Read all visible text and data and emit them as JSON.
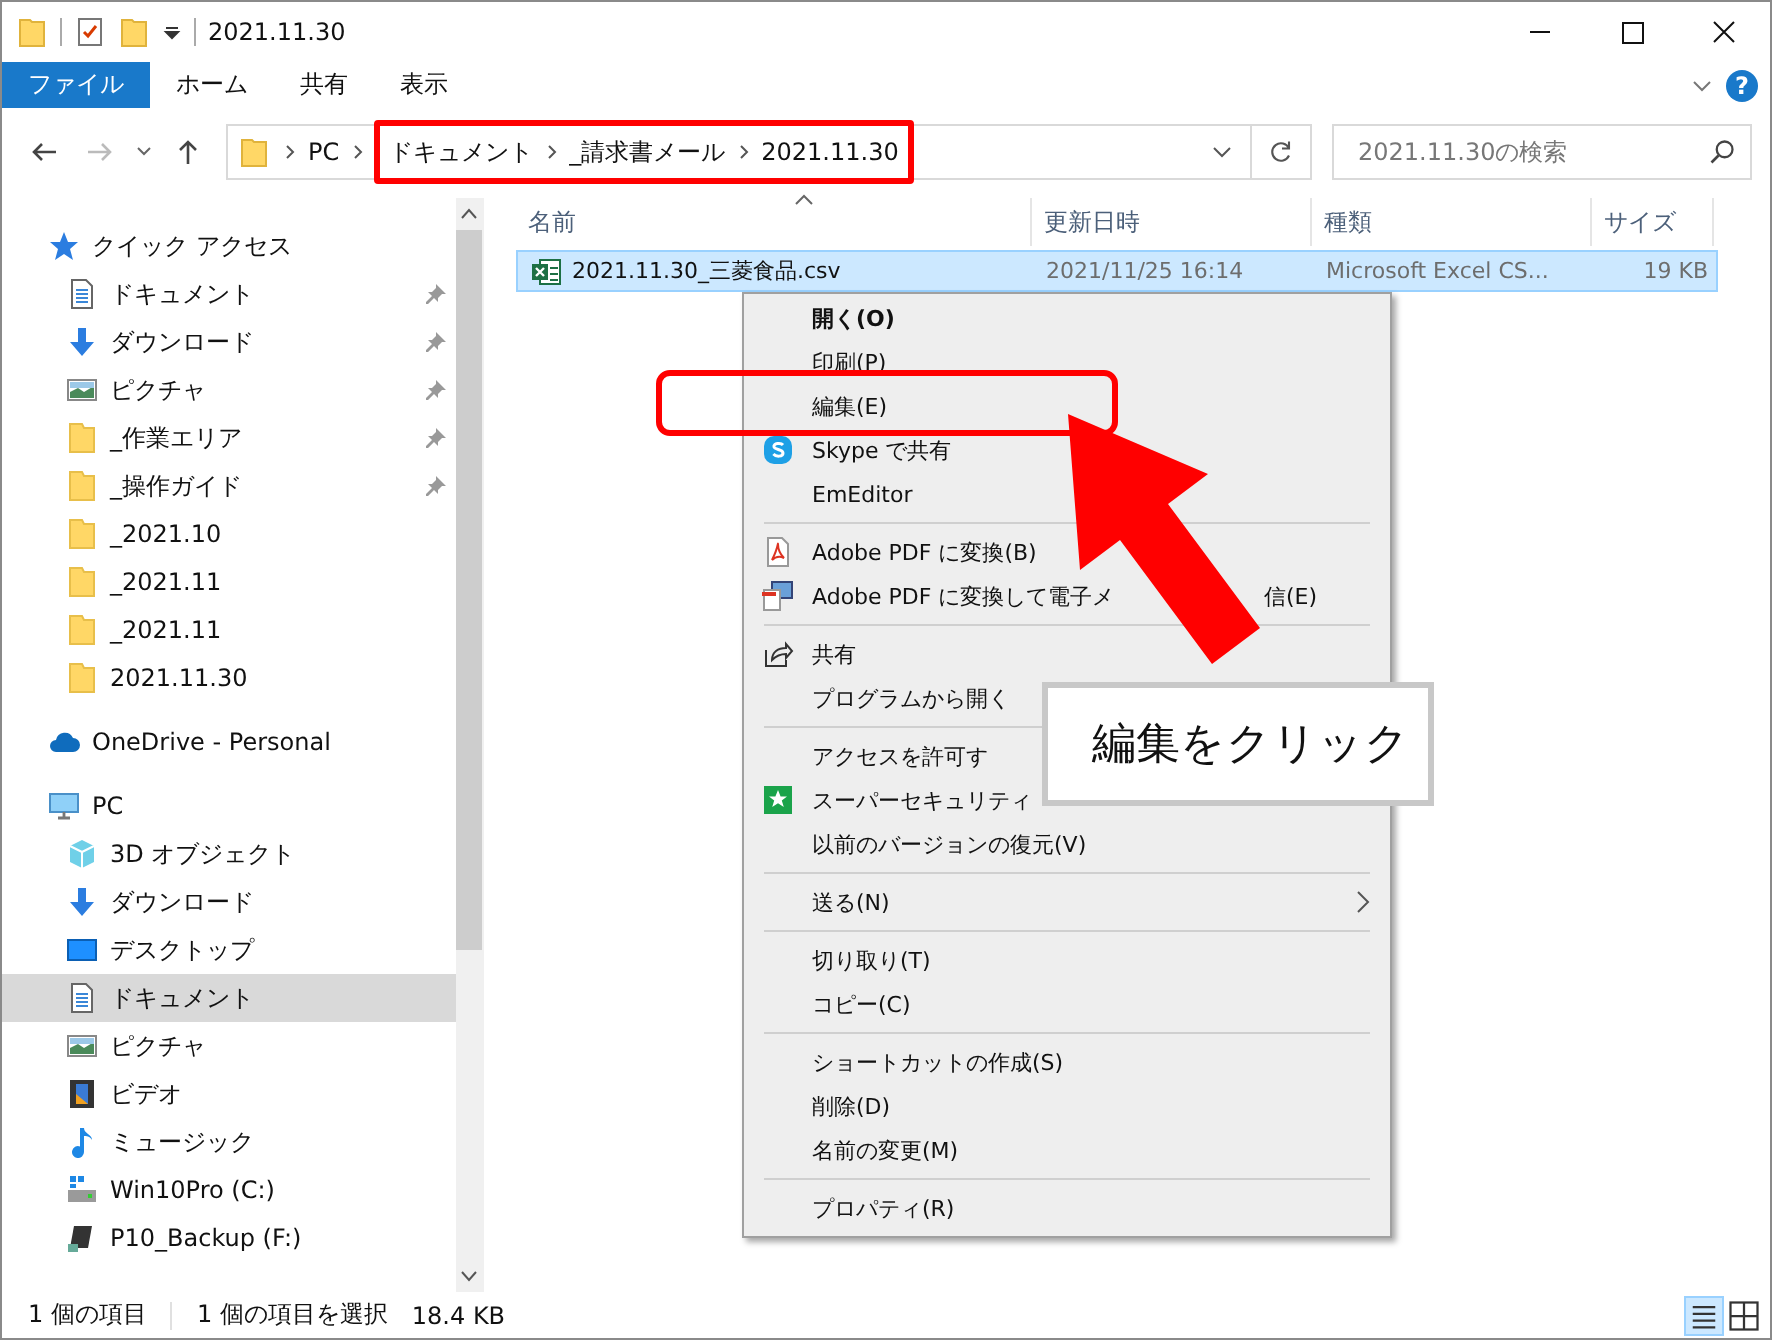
{
  "window": {
    "title": "2021.11.30"
  },
  "ribbon_tabs": [
    {
      "label": "ファイル",
      "selected": true
    },
    {
      "label": "ホーム",
      "selected": false
    },
    {
      "label": "共有",
      "selected": false
    },
    {
      "label": "表示",
      "selected": false
    }
  ],
  "help": "?",
  "address_bar": {
    "path": [
      "PC",
      "ドキュメント",
      "_請求書メール",
      "2021.11.30"
    ]
  },
  "search": {
    "placeholder": "2021.11.30の検索"
  },
  "sidebar": {
    "sections": [
      {
        "label": "クイック アクセス",
        "kind": "star",
        "selected": false,
        "children": [
          {
            "label": "ドキュメント",
            "kind": "documents",
            "pinned": true,
            "selected": false
          },
          {
            "label": "ダウンロード",
            "kind": "downloads",
            "pinned": true,
            "selected": false
          },
          {
            "label": "ピクチャ",
            "kind": "pictures",
            "pinned": true,
            "selected": false
          },
          {
            "label": "_作業エリア",
            "kind": "folder",
            "pinned": true,
            "selected": false
          },
          {
            "label": "_操作ガイド",
            "kind": "folder",
            "pinned": true,
            "selected": false
          },
          {
            "label": "_2021.10",
            "kind": "folder",
            "pinned": false,
            "selected": false
          },
          {
            "label": "_2021.11",
            "kind": "folder",
            "pinned": false,
            "selected": false
          },
          {
            "label": "_2021.11",
            "kind": "folder",
            "pinned": false,
            "selected": false
          },
          {
            "label": "2021.11.30",
            "kind": "folder",
            "pinned": false,
            "selected": false
          }
        ]
      },
      {
        "label": "OneDrive - Personal",
        "kind": "cloud",
        "selected": false
      },
      {
        "label": "PC",
        "kind": "pc",
        "selected": false,
        "children": [
          {
            "label": "3D オブジェクト",
            "kind": "objects3d",
            "pinned": false,
            "selected": false
          },
          {
            "label": "ダウンロード",
            "kind": "downloads",
            "pinned": false,
            "selected": false
          },
          {
            "label": "デスクトップ",
            "kind": "desktop",
            "pinned": false,
            "selected": false
          },
          {
            "label": "ドキュメント",
            "kind": "documents",
            "pinned": false,
            "selected": true
          },
          {
            "label": "ピクチャ",
            "kind": "pictures",
            "pinned": false,
            "selected": false
          },
          {
            "label": "ビデオ",
            "kind": "videos",
            "pinned": false,
            "selected": false
          },
          {
            "label": "ミュージック",
            "kind": "music",
            "pinned": false,
            "selected": false
          },
          {
            "label": "Win10Pro (C:)",
            "kind": "drive",
            "pinned": false,
            "selected": false
          },
          {
            "label": "P10_Backup (F:)",
            "kind": "backup",
            "pinned": false,
            "selected": false
          }
        ]
      }
    ]
  },
  "columns": [
    "名前",
    "更新日時",
    "種類",
    "サイズ"
  ],
  "files": [
    {
      "name": "2021.11.30_三菱食品.csv",
      "modified": "2021/11/25 16:14",
      "type": "Microsoft Excel CS...",
      "size": "19 KB",
      "selected": true
    }
  ],
  "context_menu": {
    "groups": [
      [
        {
          "label": "開く(O)",
          "kind": "plain",
          "default": true,
          "submenu": false
        },
        {
          "label": "印刷(P)",
          "kind": "plain",
          "default": false,
          "submenu": false
        },
        {
          "label": "編集(E)",
          "kind": "plain",
          "default": false,
          "submenu": false
        },
        {
          "label": "Skype で共有",
          "kind": "skype",
          "default": false,
          "submenu": false
        },
        {
          "label": "EmEditor",
          "kind": "plain",
          "default": false,
          "submenu": false
        }
      ],
      [
        {
          "label": "Adobe PDF に変換(B)",
          "kind": "pdf",
          "default": false,
          "submenu": false
        },
        {
          "label": "Adobe PDF に変換して電子メ",
          "label_tail": "信(E)",
          "kind": "pdf-mail",
          "default": false,
          "submenu": false
        }
      ],
      [
        {
          "label": "共有",
          "kind": "share",
          "default": false,
          "submenu": false
        },
        {
          "label": "プログラムから開く",
          "kind": "plain",
          "default": false,
          "submenu": false
        }
      ],
      [
        {
          "label": "アクセスを許可す",
          "kind": "plain",
          "default": false,
          "submenu": false
        },
        {
          "label": "スーパーセキュリティ",
          "kind": "security",
          "default": false,
          "submenu": false
        },
        {
          "label": "以前のバージョンの復元(V)",
          "kind": "plain",
          "default": false,
          "submenu": false
        }
      ],
      [
        {
          "label": "送る(N)",
          "kind": "plain",
          "default": false,
          "submenu": true
        }
      ],
      [
        {
          "label": "切り取り(T)",
          "kind": "plain",
          "default": false,
          "submenu": false
        },
        {
          "label": "コピー(C)",
          "kind": "plain",
          "default": false,
          "submenu": false
        }
      ],
      [
        {
          "label": "ショートカットの作成(S)",
          "kind": "plain",
          "default": false,
          "submenu": false
        },
        {
          "label": "削除(D)",
          "kind": "plain",
          "default": false,
          "submenu": false
        },
        {
          "label": "名前の変更(M)",
          "kind": "plain",
          "default": false,
          "submenu": false
        }
      ],
      [
        {
          "label": "プロパティ(R)",
          "kind": "plain",
          "default": false,
          "submenu": false
        }
      ]
    ]
  },
  "callout": "編集をクリック",
  "status_bar": {
    "items": "1 個の項目",
    "selection": "1 個の項目を選択",
    "size": "18.4 KB"
  }
}
